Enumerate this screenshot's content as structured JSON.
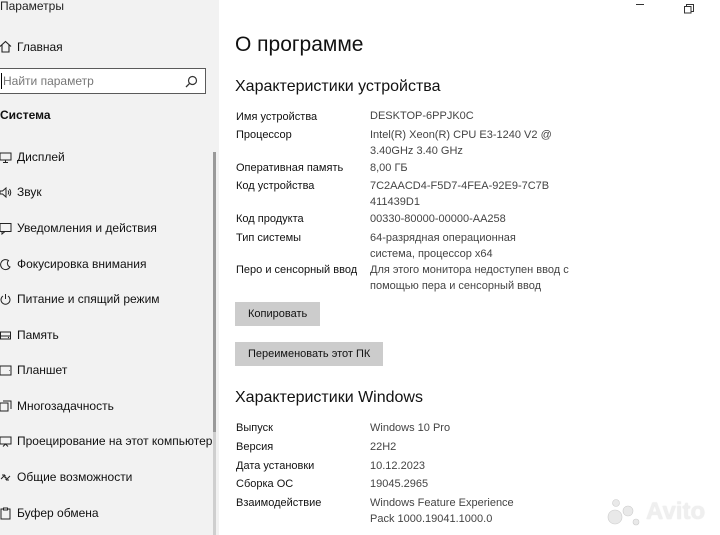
{
  "app": {
    "title": "Параметры"
  },
  "sidebar": {
    "home_label": "Главная",
    "search_placeholder": "Найти параметр",
    "section_title": "Система",
    "items": [
      {
        "label": "Дисплей",
        "icon": "display-icon"
      },
      {
        "label": "Звук",
        "icon": "sound-icon"
      },
      {
        "label": "Уведомления и действия",
        "icon": "notifications-icon"
      },
      {
        "label": "Фокусировка внимания",
        "icon": "focus-assist-icon"
      },
      {
        "label": "Питание и спящий режим",
        "icon": "power-icon"
      },
      {
        "label": "Память",
        "icon": "storage-icon"
      },
      {
        "label": "Планшет",
        "icon": "tablet-icon"
      },
      {
        "label": "Многозадачность",
        "icon": "multitasking-icon"
      },
      {
        "label": "Проецирование на этот компьютер",
        "icon": "projecting-icon"
      },
      {
        "label": "Общие возможности",
        "icon": "shared-experiences-icon"
      },
      {
        "label": "Буфер обмена",
        "icon": "clipboard-icon"
      }
    ]
  },
  "main": {
    "title": "О программе",
    "device_heading": "Характеристики устройства",
    "device": [
      {
        "label": "Имя устройства",
        "value": "DESKTOP-6PPJK0C"
      },
      {
        "label": "Процессор",
        "value": "Intel(R) Xeon(R) CPU E3-1240 V2 @ 3.40GHz   3.40 GHz"
      },
      {
        "label": "Оперативная память",
        "value": "8,00 ГБ"
      },
      {
        "label": "Код устройства",
        "value": "7C2AACD4-F5D7-4FEA-92E9-7C7B411439D1"
      },
      {
        "label": "Код продукта",
        "value": "00330-80000-00000-AA258"
      },
      {
        "label": "Тип системы",
        "value": "64-разрядная операционная система, процессор x64"
      },
      {
        "label": "Перо и сенсорный ввод",
        "value": "Для этого монитора недоступен ввод с помощью пера и сенсорный ввод"
      }
    ],
    "copy_button": "Копировать",
    "rename_button": "Переименовать этот ПК",
    "windows_heading": "Характеристики Windows",
    "windows": [
      {
        "label": "Выпуск",
        "value": "Windows 10 Pro"
      },
      {
        "label": "Версия",
        "value": "22H2"
      },
      {
        "label": "Дата установки",
        "value": "10.12.2023"
      },
      {
        "label": "Сборка ОС",
        "value": "19045.2965"
      },
      {
        "label": "Взаимодействие",
        "value": "Windows Feature Experience Pack 1000.19041.1000.0"
      }
    ]
  },
  "watermark": {
    "text": "Avito"
  }
}
